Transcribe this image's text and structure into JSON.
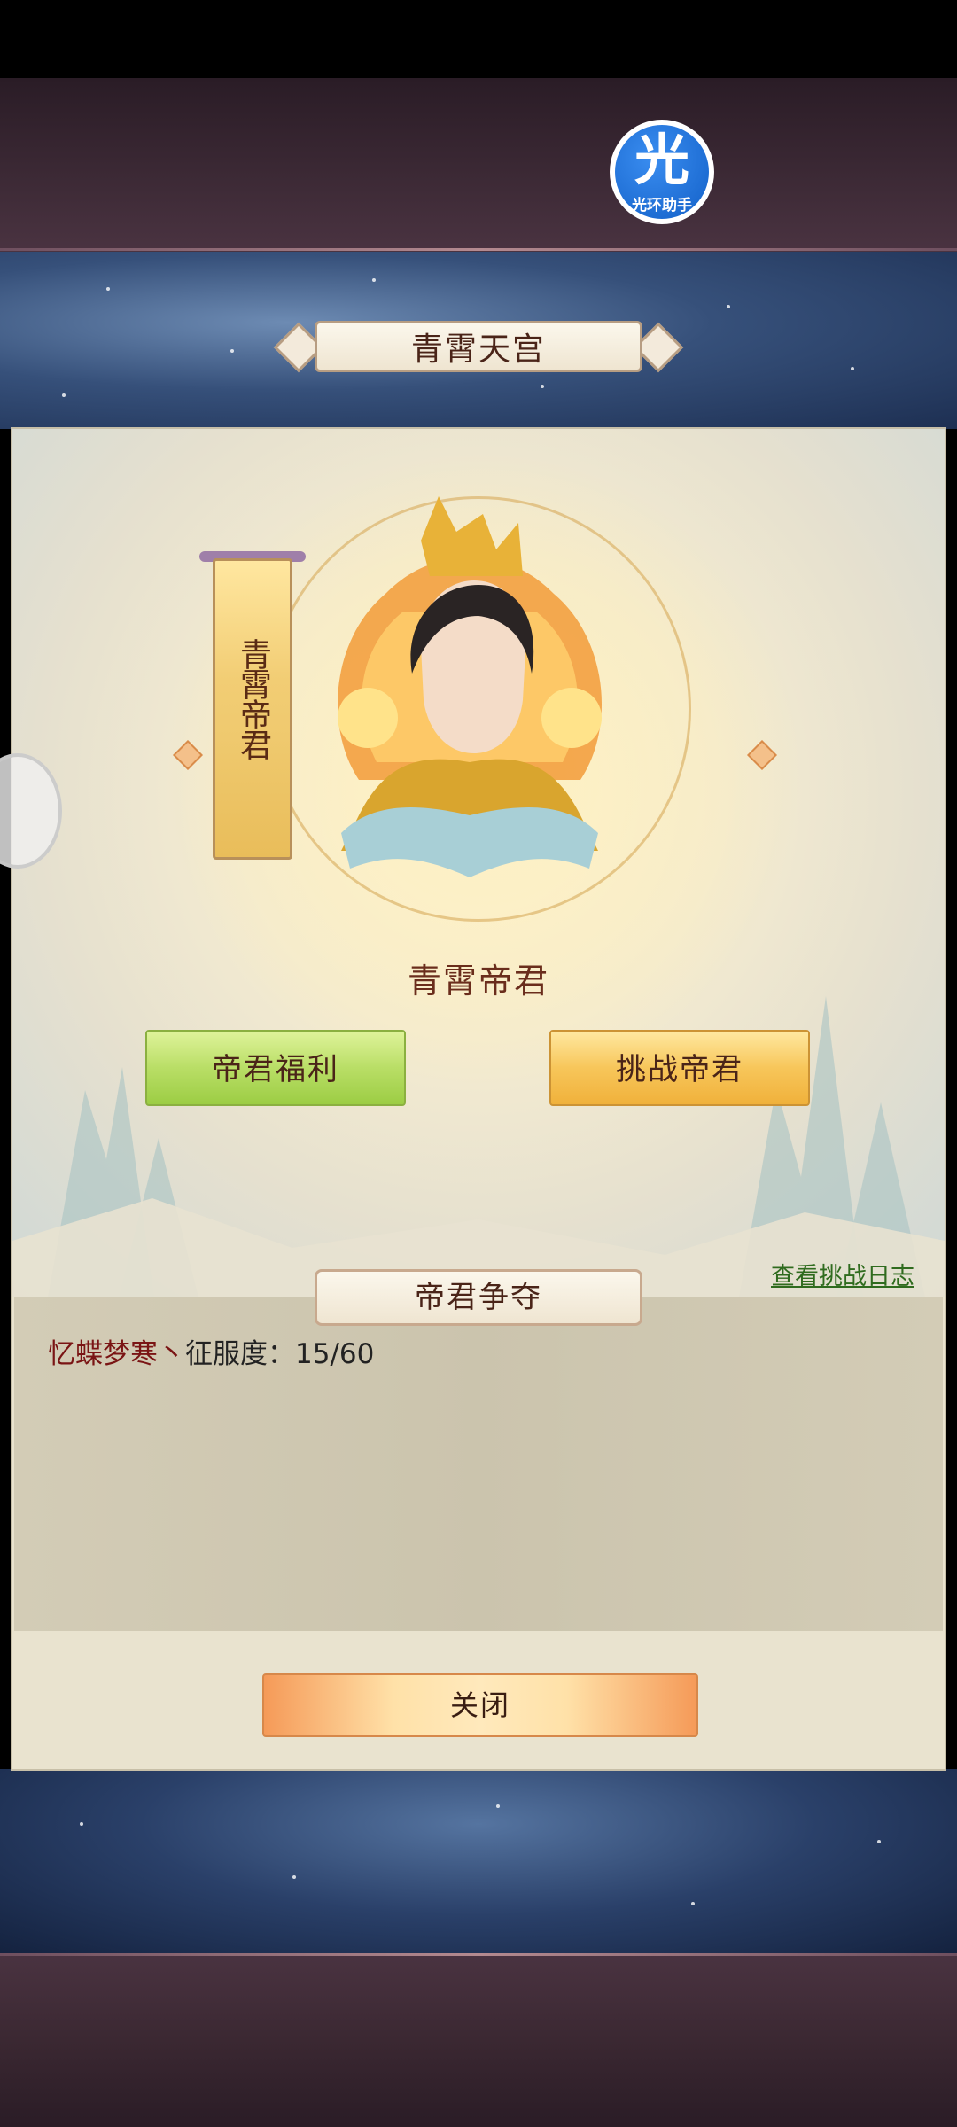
{
  "header": {
    "title": "青霄天宫",
    "overlay_logo": {
      "char": "光",
      "label": "光环助手",
      "icon": "halo-assistant-logo-icon"
    }
  },
  "boss": {
    "banner_text": "青霄帝君",
    "name": "青霄帝君"
  },
  "actions": {
    "welfare_label": "帝君福利",
    "challenge_label": "挑战帝君",
    "log_link": "查看挑战日志"
  },
  "contest": {
    "title": "帝君争夺",
    "player_name": "忆蝶梦寒丶",
    "stat_label": "征服度：",
    "stat_value": "15/60"
  },
  "footer": {
    "close_label": "关闭"
  },
  "colors": {
    "welfare_button": "#b9de66",
    "challenge_button": "#f7c65a",
    "close_button": "#ffe1a8",
    "log_link": "#2f6b1e",
    "player_name": "#7a1414"
  }
}
